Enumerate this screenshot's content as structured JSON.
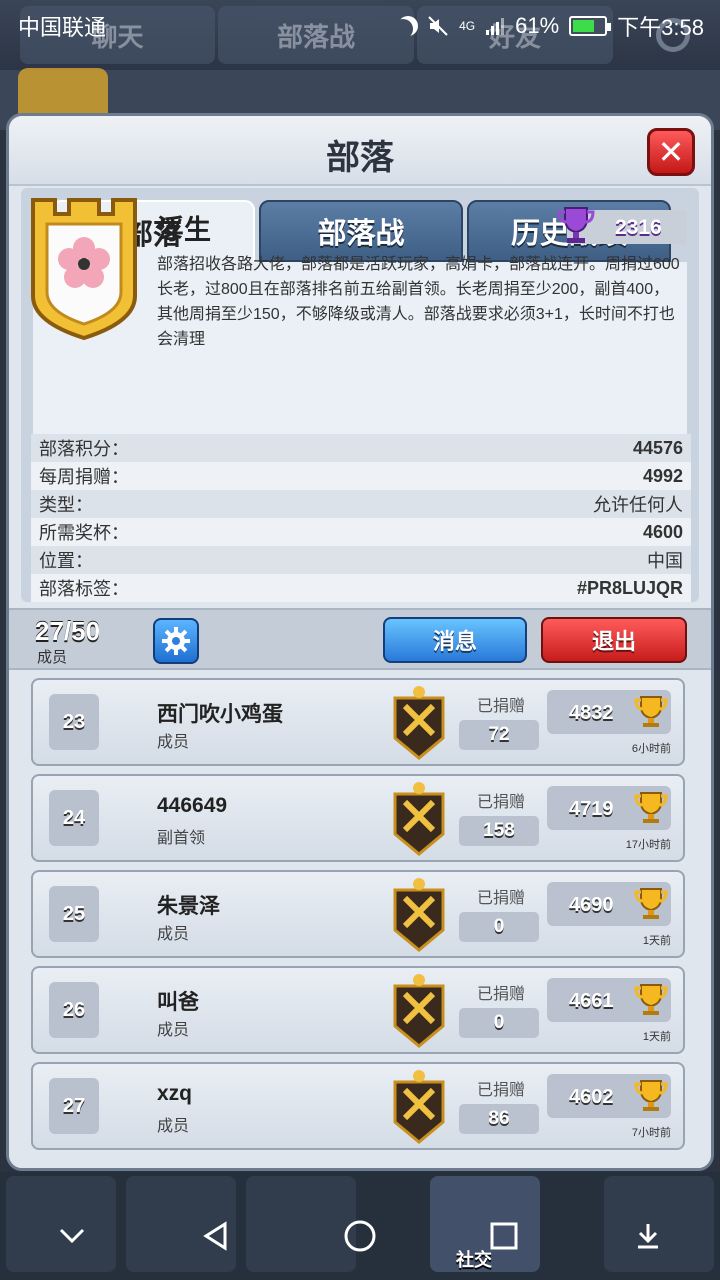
{
  "status_bar": {
    "carrier": "中国联通",
    "network": "4G",
    "battery": "61%",
    "time": "下午3:58"
  },
  "background_tabs": [
    "聊天",
    "部落战",
    "好友"
  ],
  "modal": {
    "title": "部落",
    "tabs": [
      "部落",
      "部落战",
      "历史战绩"
    ],
    "clan": {
      "name": "浮生",
      "trophies": "2316",
      "description": "部落招收各路大佬，部落都是活跃玩家，高娟卡，部落战连开。周捐过600长老，过800且在部落排名前五给副首领。长老周捐至少200，副首400，其他周捐至少150，不够降级或清人。部落战要求必须3+1，长时间不打也会清理"
    },
    "stats": [
      {
        "label": "部落积分：",
        "value": "44576"
      },
      {
        "label": "每周捐赠：",
        "value": "4992"
      },
      {
        "label": "类型：",
        "value": "允许任何人"
      },
      {
        "label": "所需奖杯：",
        "value": "4600"
      },
      {
        "label": "位置：",
        "value": "中国"
      },
      {
        "label": "部落标签：",
        "value": "#PR8LUJQR"
      }
    ],
    "toolbar": {
      "members_count": "27/50",
      "members_label": "成员",
      "message_button": "消息",
      "exit_button": "退出"
    },
    "donated_label": "已捐赠",
    "members": [
      {
        "rank": "23",
        "name": "西门吹小鸡蛋",
        "role": "成员",
        "donated": "72",
        "trophies": "4832",
        "last_seen": "6小时前"
      },
      {
        "rank": "24",
        "name": "446649",
        "role": "副首领",
        "donated": "158",
        "trophies": "4719",
        "last_seen": "17小时前"
      },
      {
        "rank": "25",
        "name": "朱景泽",
        "role": "成员",
        "donated": "0",
        "trophies": "4690",
        "last_seen": "1天前"
      },
      {
        "rank": "26",
        "name": "叫爸",
        "role": "成员",
        "donated": "0",
        "trophies": "4661",
        "last_seen": "1天前"
      },
      {
        "rank": "27",
        "name": "xzq",
        "role": "成员",
        "donated": "86",
        "trophies": "4602",
        "last_seen": "7小时前"
      }
    ]
  },
  "bottom_nav": {
    "social_label": "社交"
  },
  "colors": {
    "accent_blue": "#2979d9",
    "exit_red": "#c71c1c",
    "gold": "#d9a52a",
    "purple_trophy": "#8b3fd0"
  }
}
